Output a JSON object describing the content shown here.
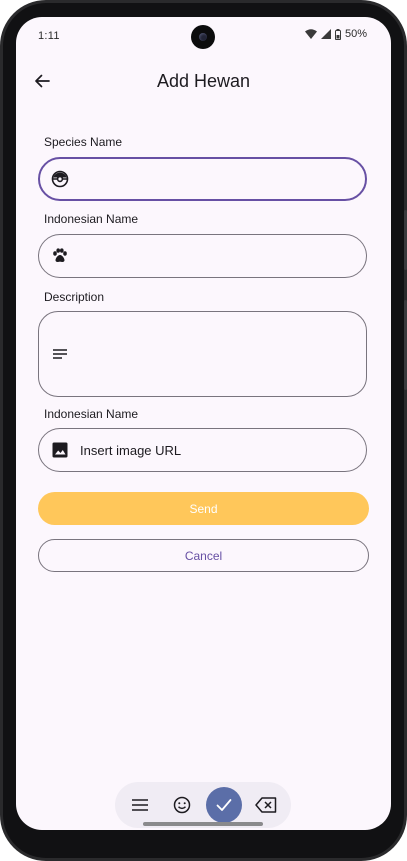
{
  "status_bar": {
    "time": "1:11",
    "battery": "50%"
  },
  "app_bar": {
    "title": "Add Hewan"
  },
  "form": {
    "species": {
      "label": "Species Name",
      "value": "",
      "icon": "pokeball-icon"
    },
    "indonesian": {
      "label": "Indonesian Name",
      "value": "",
      "icon": "paw-icon"
    },
    "description": {
      "label": "Description",
      "value": "",
      "icon": "notes-icon"
    },
    "image": {
      "label": "Indonesian Name",
      "placeholder": "Insert image URL",
      "icon": "image-icon"
    }
  },
  "buttons": {
    "send": "Send",
    "cancel": "Cancel"
  },
  "colors": {
    "accent": "#6750a4",
    "send": "#ffc75a",
    "background": "#fcf7fd",
    "keyboard_check": "#5b6ea8"
  },
  "keyboard_toolbar": [
    "menu-icon",
    "emoji-icon",
    "check-icon",
    "backspace-icon"
  ]
}
